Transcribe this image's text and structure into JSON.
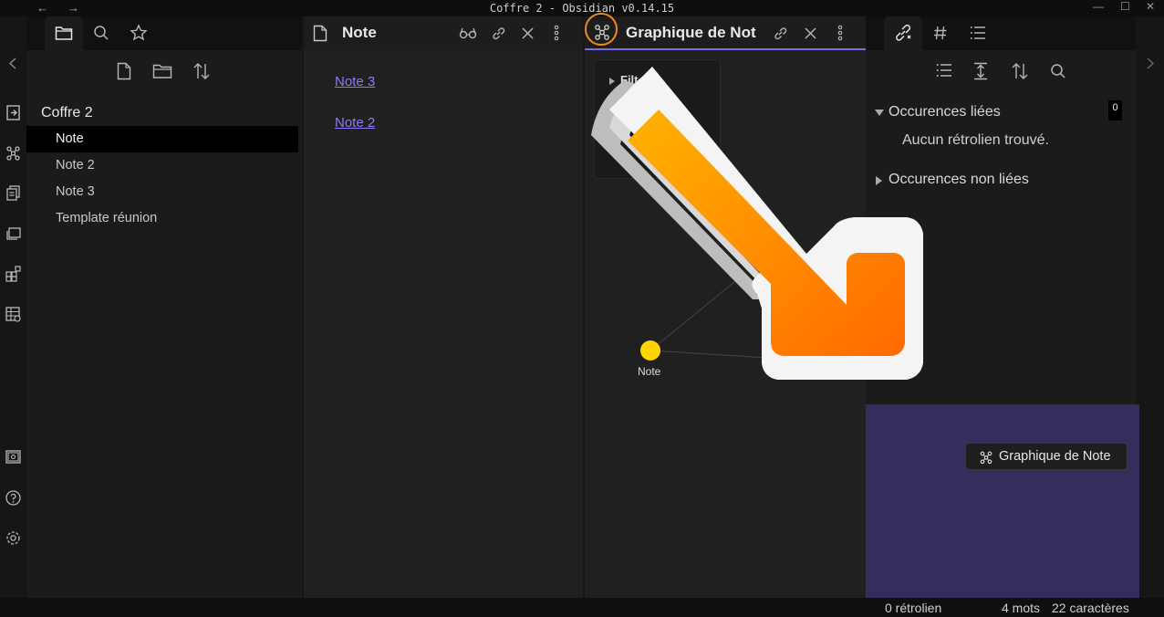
{
  "window": {
    "title": "Coffre 2 - Obsidian v0.14.15",
    "back_glyph": "←",
    "forward_glyph": "→",
    "minimize_glyph": "—",
    "maximize_glyph": "☐",
    "close_glyph": "✕"
  },
  "left_sidebar": {
    "tabs": [
      "folder-icon",
      "search-icon",
      "star-icon"
    ],
    "toolbar": [
      "new-note-icon",
      "new-folder-icon",
      "sort-icon"
    ],
    "vault_name": "Coffre 2",
    "files": [
      {
        "label": "Note",
        "active": true
      },
      {
        "label": "Note 2",
        "active": false
      },
      {
        "label": "Note 3",
        "active": false
      },
      {
        "label": "Template réunion",
        "active": false
      }
    ]
  },
  "note_tab": {
    "title": "Note",
    "links": [
      "Note 3",
      "Note 2"
    ],
    "actions": [
      "reading-view-icon",
      "link-icon",
      "close-icon",
      "more-options-icon"
    ]
  },
  "graph_tab": {
    "title": "Graphique de Not",
    "filters_label": "Filt",
    "node_label": "Note",
    "node_color": "#ffd500",
    "actions": [
      "link-icon",
      "close-icon",
      "more-options-icon"
    ]
  },
  "right_sidebar": {
    "tabs": [
      "backlinks-icon",
      "tag-icon",
      "outline-icon"
    ],
    "linked_title": "Occurences liées",
    "linked_count": "0",
    "linked_empty": "Aucun rétrolien trouvé.",
    "unlinked_title": "Occurences non liées"
  },
  "drag_preview": {
    "label": "Graphique de Note",
    "zone_color": "#352d5c"
  },
  "status_bar": {
    "backlinks": "0 rétrolien",
    "words": "4 mots",
    "chars": "22 caractères"
  },
  "colors": {
    "accent": "#7c6ae8",
    "link": "#8a7cf5",
    "highlight_ring": "#f08a1c",
    "arrow_orange": "#ff7a00"
  }
}
